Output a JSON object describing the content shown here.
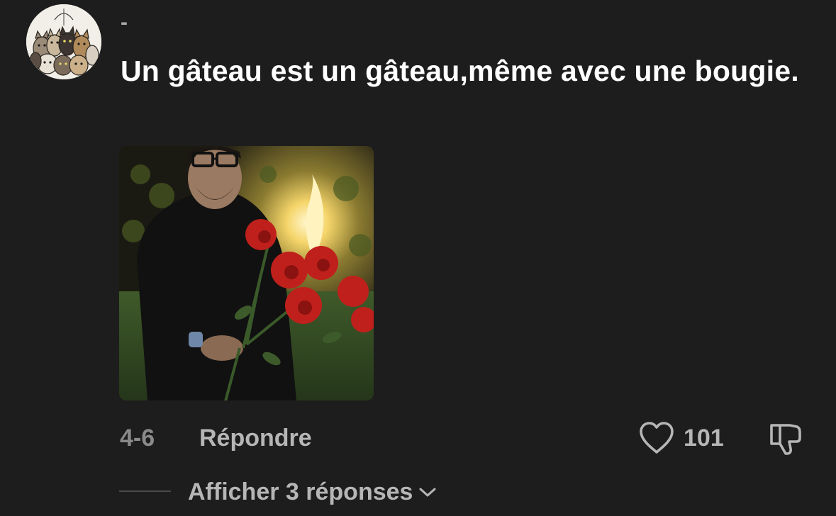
{
  "comment": {
    "username": "-",
    "text": "Un gâteau est un gâteau,même avec une bougie.",
    "date": "4-6",
    "reply_label": "Répondre",
    "likes": "101",
    "view_replies_label": "Afficher 3 réponses"
  },
  "icons": {
    "like": "heart-icon",
    "dislike": "thumbs-down-icon",
    "expand": "chevron-down-icon"
  },
  "colors": {
    "background": "#1d1d1d",
    "text_primary": "#ffffff",
    "text_secondary": "#b6b6b6",
    "text_muted": "#8a8a8a"
  }
}
